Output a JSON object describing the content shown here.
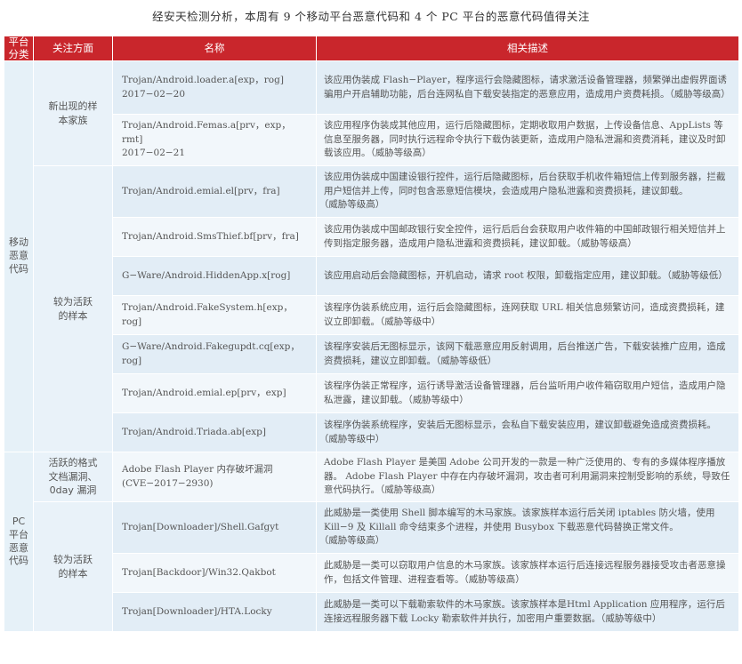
{
  "caption": "经安天检测分析，本周有 9 个移动平台恶意代码和 4 个 PC 平台的恶意代码值得关注",
  "table": {
    "headers": [
      "平台\n分类",
      "关注方面",
      "名称",
      "相关描述"
    ],
    "groups": [
      {
        "category": "移动\n恶意\n代码",
        "subgroups": [
          {
            "focus": "新出现的样\n本家族",
            "rows": [
              {
                "name": "Trojan/Android.loader.a[exp，rog]\n2017−02−20",
                "desc": "该应用伪装成 Flash−Player，程序运行会隐藏图标，请求激活设备管理器，频繁弹出虚假界面诱骗用户开启辅助功能，后台连网私自下载安装指定的恶意应用，造成用户资费耗损。",
                "level": "（威胁等级高）"
              },
              {
                "name": "Trojan/Android.Femas.a[prv，exp，rmt]\n2017−02−21",
                "desc": "该应用程序伪装成其他应用，运行后隐藏图标，定期收取用户数据，上传设备信息、AppLists 等信息至服务器，同时执行远程命令执行下载伪装更新，造成用户隐私泄漏和资费消耗，建议及时卸载该应用。",
                "level": "（威胁等级高）"
              }
            ]
          },
          {
            "focus": "较为活跃\n的样本",
            "rows": [
              {
                "name": "Trojan/Android.emial.el[prv，fra]",
                "desc": "该应用伪装成中国建设银行控件，运行后隐藏图标，后台获取手机收件箱短信上传到服务器，拦截用户短信并上传，同时包含恶意短信模块，会造成用户隐私泄露和资费损耗，建议卸载。",
                "level": "（威胁等级高）"
              },
              {
                "name": "Trojan/Android.SmsThief.bf[prv，fra]",
                "desc": "该应用伪装成中国邮政银行安全控件，运行后后台会获取用户收件箱的中国邮政银行相关短信并上传到指定服务器，造成用户隐私泄露和资费损耗，建议卸载。",
                "level": "（威胁等级高）"
              },
              {
                "name": "G−Ware/Android.HiddenApp.x[rog]",
                "desc": "该应用启动后会隐藏图标，开机启动，请求 root 权限，卸载指定应用，建议卸载。",
                "level": "（威胁等级低）"
              },
              {
                "name": "Trojan/Android.FakeSystem.h[exp，rog]",
                "desc": "该程序伪装系统应用，运行后会隐藏图标，连网获取 URL 相关信息频繁访问，造成资费损耗，建议立即卸载。",
                "level": "（威胁等级中）"
              },
              {
                "name": "G−Ware/Android.Fakegupdt.cq[exp，rog]",
                "desc": "该程序安装后无图标显示，该网下载恶意应用反射调用，后台推送广告，下载安装推广应用，造成资费损耗，建议立即卸载。",
                "level": "（威胁等级低）"
              },
              {
                "name": "Trojan/Android.emial.ep[prv，exp]",
                "desc": "该程序伪装正常程序，运行诱导激活设备管理器，后台监听用户收件箱窃取用户短信，造成用户隐私泄露，建议卸载。",
                "level": "（威胁等级中）"
              },
              {
                "name": "Trojan/Android.Triada.ab[exp]",
                "desc": "该程序伪装系统程序，安装后无图标显示，会私自下载安装应用，建议卸载避免造成资费损耗。",
                "level": "（威胁等级中）"
              }
            ]
          }
        ]
      },
      {
        "category": "PC\n平台\n恶意\n代码",
        "subgroups": [
          {
            "focus": "活跃的格式\n文档漏洞、\n0day 漏洞",
            "rows": [
              {
                "name": "Adobe Flash Player 内存破坏漏洞\n(CVE−2017−2930)",
                "desc": "Adobe Flash Player 是美国 Adobe 公司开发的一款是一种广泛使用的、专有的多媒体程序播放器。 Adobe Flash Player 中存在内存破坏漏洞，攻击者可利用漏洞来控制受影响的系统，导致任意代码执行。",
                "level": "（威胁等级高）"
              }
            ]
          },
          {
            "focus": "较为活跃\n的样本",
            "rows": [
              {
                "name": "Trojan[Downloader]/Shell.Gafgyt",
                "desc": "此威胁是一类使用 Shell 脚本编写的木马家族。该家族样本运行后关闭 iptables 防火墙，使用 Kill−9 及 Killall 命令结束多个进程，并使用 Busybox 下载恶意代码替换正常文件。",
                "level": "（威胁等级高）"
              },
              {
                "name": "Trojan[Backdoor]/Win32.Qakbot",
                "desc": "此威胁是一类可以窃取用户信息的木马家族。该家族样本运行后连接远程服务器接受攻击者恶意操作，包括文件管理、进程查看等。",
                "level": "（威胁等级高）"
              },
              {
                "name": "Trojan[Downloader]/HTA.Locky",
                "desc": "此威胁是一类可以下载勒索软件的木马家族。该家族样本是Html Application 应用程序，运行后连接远程服务器下载 Locky 勒索软件并执行，加密用户重要数据。",
                "level": "（威胁等级中）"
              }
            ]
          }
        ]
      }
    ]
  }
}
